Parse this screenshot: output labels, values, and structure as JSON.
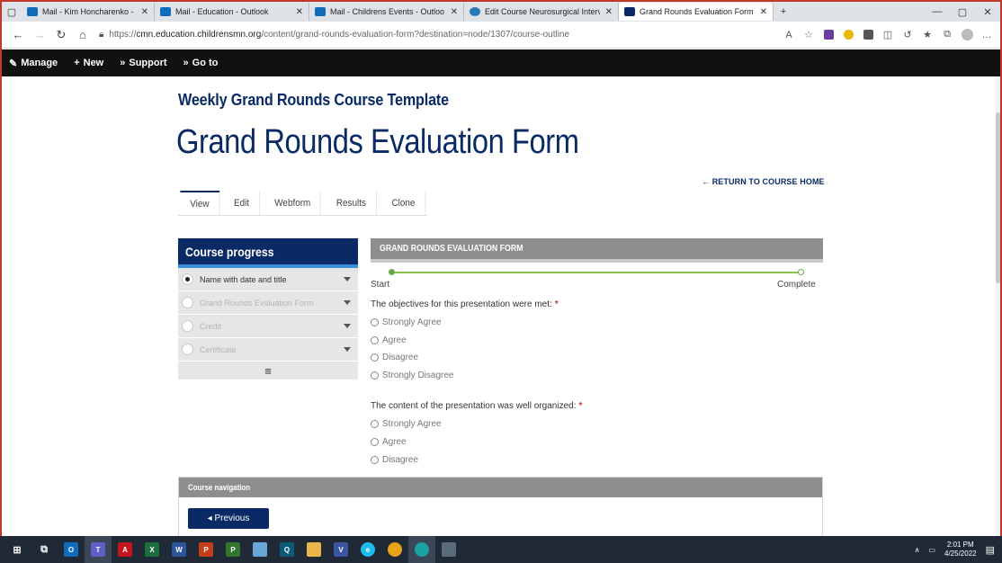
{
  "browser": {
    "tabs": [
      {
        "title": "Mail - Kim Honcharenko - Outlo",
        "color": "#0f6cbd"
      },
      {
        "title": "Mail - Education - Outlook",
        "color": "#0f6cbd"
      },
      {
        "title": "Mail - Childrens Events - Outloo",
        "color": "#0f6cbd"
      },
      {
        "title": "Edit Course Neurosurgical Interv",
        "color": "#2a7ab8"
      },
      {
        "title": "Grand Rounds Evaluation Form |",
        "color": "#0a2a66"
      }
    ],
    "url_scheme": "https://",
    "url_host": "cmn.education.childrensmn.org",
    "url_path": "/content/grand-rounds-evaluation-form?destination=node/1307/course-outline"
  },
  "admin_toolbar": {
    "manage": "Manage",
    "new": "New",
    "support": "Support",
    "goto": "Go to"
  },
  "page": {
    "course_title": "Weekly Grand Rounds Course Template",
    "title": "Grand Rounds Evaluation Form",
    "return_link": "← RETURN TO COURSE HOME",
    "tabs": [
      "View",
      "Edit",
      "Webform",
      "Results",
      "Clone"
    ]
  },
  "course_progress": {
    "heading": "Course progress",
    "items": [
      {
        "label": "Name with date and title"
      },
      {
        "label": "Grand Rounds Evaluation Form"
      },
      {
        "label": "Credit"
      },
      {
        "label": "Certificate"
      }
    ],
    "menu_glyph": "≡"
  },
  "form": {
    "heading": "GRAND ROUNDS EVALUATION FORM",
    "progress_start": "Start",
    "progress_end": "Complete",
    "progress_fraction": 0,
    "q1": {
      "text": "The objectives for this presentation were met:",
      "required_mark": "*",
      "options": [
        "Strongly Agree",
        "Agree",
        "Disagree",
        "Strongly Disagree"
      ]
    },
    "q2": {
      "text": "The content of the presentation was well organized:",
      "required_mark": "*",
      "options": [
        "Strongly Agree",
        "Agree",
        "Disagree"
      ]
    }
  },
  "course_nav": {
    "heading": "Course navigation",
    "previous": "◂ Previous"
  },
  "taskbar": {
    "time": "2:01 PM",
    "date": "4/25/2022"
  },
  "colors": {
    "brand": "#0a2a66",
    "accent": "#3a8fd6",
    "progress": "#6aa84f",
    "required": "#c0392b"
  }
}
